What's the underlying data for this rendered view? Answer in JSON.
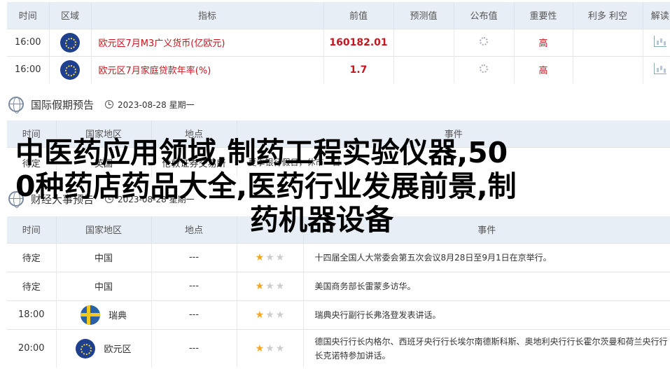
{
  "table1": {
    "headers": [
      "时间",
      "区域",
      "指标",
      "前值",
      "预测值",
      "公布值",
      "重要性",
      "利多 利空",
      "解读"
    ],
    "rows": [
      {
        "time": "16:00",
        "flag": "eu-flag-icon",
        "indicator": "欧元区7月M3广义货币(亿欧元)",
        "previous": "160182.01",
        "forecast": "",
        "actual": "loading-icon",
        "importance": "高",
        "bias": "",
        "interpret": "chart-icon"
      },
      {
        "time": "16:00",
        "flag": "eu-flag-icon",
        "indicator": "欧元区7月家庭贷款年率(%)",
        "previous": "1.7",
        "forecast": "",
        "actual": "loading-icon",
        "importance": "高",
        "bias": "",
        "interpret": "chart-icon"
      }
    ]
  },
  "holiday": {
    "title": "国际假期预告",
    "date": "2023-08-28 星期一",
    "headers": [
      "时间",
      "国家地区",
      "地点",
      "事件"
    ],
    "rows": [
      {
        "time": "待定",
        "country": "英国",
        "place": "伦敦证券交易所",
        "event": "夏季银行假日，休市一日"
      }
    ]
  },
  "events": {
    "title": "财经大事预告",
    "date": "2023-08-28 星期一",
    "headers": [
      "时间",
      "国家地区",
      "地点",
      "",
      "事件"
    ],
    "rows": [
      {
        "time": "待定",
        "country": "中国",
        "place": "---",
        "stars": 1,
        "event": "十四届全国人大常委会第五次会议8月28日至9月1日在京举行。"
      },
      {
        "time": "待定",
        "country": "中国",
        "place": "---",
        "stars": 1,
        "event": "美国商务部长雷蒙多访华。"
      },
      {
        "time": "18:00",
        "country": "瑞典",
        "flag": "se-flag-icon",
        "place": "---",
        "stars": 1,
        "event": "瑞典央行副行长弗洛登发表讲话。"
      },
      {
        "time": "20:00",
        "country": "欧元区",
        "flag": "eu-flag-icon",
        "place": "---",
        "stars": 1,
        "event": "德国央行行长内格尔、西班牙央行行长埃尔南德斯科斯、奥地利央行行长霍尔茨曼和荷兰央行行长克诺特参加讲话。"
      }
    ]
  },
  "overlay": {
    "line1": "中医药应用领域,制药工程实验仪器,50",
    "line2": "0种药店药品大全,医药行业发展前景,制",
    "line3": "药机器设备"
  }
}
